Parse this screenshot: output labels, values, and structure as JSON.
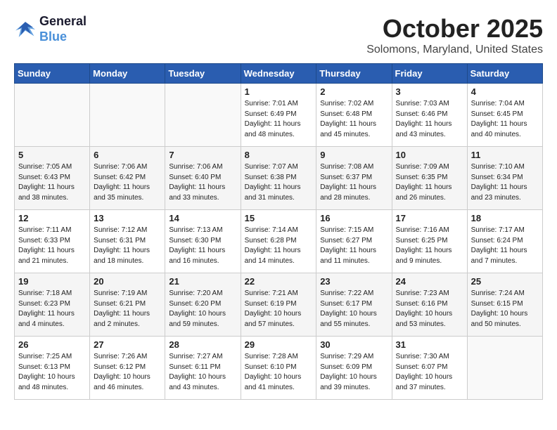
{
  "header": {
    "logo_line1": "General",
    "logo_line2": "Blue",
    "month": "October 2025",
    "location": "Solomons, Maryland, United States"
  },
  "weekdays": [
    "Sunday",
    "Monday",
    "Tuesday",
    "Wednesday",
    "Thursday",
    "Friday",
    "Saturday"
  ],
  "weeks": [
    [
      {
        "day": "",
        "info": ""
      },
      {
        "day": "",
        "info": ""
      },
      {
        "day": "",
        "info": ""
      },
      {
        "day": "1",
        "info": "Sunrise: 7:01 AM\nSunset: 6:49 PM\nDaylight: 11 hours\nand 48 minutes."
      },
      {
        "day": "2",
        "info": "Sunrise: 7:02 AM\nSunset: 6:48 PM\nDaylight: 11 hours\nand 45 minutes."
      },
      {
        "day": "3",
        "info": "Sunrise: 7:03 AM\nSunset: 6:46 PM\nDaylight: 11 hours\nand 43 minutes."
      },
      {
        "day": "4",
        "info": "Sunrise: 7:04 AM\nSunset: 6:45 PM\nDaylight: 11 hours\nand 40 minutes."
      }
    ],
    [
      {
        "day": "5",
        "info": "Sunrise: 7:05 AM\nSunset: 6:43 PM\nDaylight: 11 hours\nand 38 minutes."
      },
      {
        "day": "6",
        "info": "Sunrise: 7:06 AM\nSunset: 6:42 PM\nDaylight: 11 hours\nand 35 minutes."
      },
      {
        "day": "7",
        "info": "Sunrise: 7:06 AM\nSunset: 6:40 PM\nDaylight: 11 hours\nand 33 minutes."
      },
      {
        "day": "8",
        "info": "Sunrise: 7:07 AM\nSunset: 6:38 PM\nDaylight: 11 hours\nand 31 minutes."
      },
      {
        "day": "9",
        "info": "Sunrise: 7:08 AM\nSunset: 6:37 PM\nDaylight: 11 hours\nand 28 minutes."
      },
      {
        "day": "10",
        "info": "Sunrise: 7:09 AM\nSunset: 6:35 PM\nDaylight: 11 hours\nand 26 minutes."
      },
      {
        "day": "11",
        "info": "Sunrise: 7:10 AM\nSunset: 6:34 PM\nDaylight: 11 hours\nand 23 minutes."
      }
    ],
    [
      {
        "day": "12",
        "info": "Sunrise: 7:11 AM\nSunset: 6:33 PM\nDaylight: 11 hours\nand 21 minutes."
      },
      {
        "day": "13",
        "info": "Sunrise: 7:12 AM\nSunset: 6:31 PM\nDaylight: 11 hours\nand 18 minutes."
      },
      {
        "day": "14",
        "info": "Sunrise: 7:13 AM\nSunset: 6:30 PM\nDaylight: 11 hours\nand 16 minutes."
      },
      {
        "day": "15",
        "info": "Sunrise: 7:14 AM\nSunset: 6:28 PM\nDaylight: 11 hours\nand 14 minutes."
      },
      {
        "day": "16",
        "info": "Sunrise: 7:15 AM\nSunset: 6:27 PM\nDaylight: 11 hours\nand 11 minutes."
      },
      {
        "day": "17",
        "info": "Sunrise: 7:16 AM\nSunset: 6:25 PM\nDaylight: 11 hours\nand 9 minutes."
      },
      {
        "day": "18",
        "info": "Sunrise: 7:17 AM\nSunset: 6:24 PM\nDaylight: 11 hours\nand 7 minutes."
      }
    ],
    [
      {
        "day": "19",
        "info": "Sunrise: 7:18 AM\nSunset: 6:23 PM\nDaylight: 11 hours\nand 4 minutes."
      },
      {
        "day": "20",
        "info": "Sunrise: 7:19 AM\nSunset: 6:21 PM\nDaylight: 11 hours\nand 2 minutes."
      },
      {
        "day": "21",
        "info": "Sunrise: 7:20 AM\nSunset: 6:20 PM\nDaylight: 10 hours\nand 59 minutes."
      },
      {
        "day": "22",
        "info": "Sunrise: 7:21 AM\nSunset: 6:19 PM\nDaylight: 10 hours\nand 57 minutes."
      },
      {
        "day": "23",
        "info": "Sunrise: 7:22 AM\nSunset: 6:17 PM\nDaylight: 10 hours\nand 55 minutes."
      },
      {
        "day": "24",
        "info": "Sunrise: 7:23 AM\nSunset: 6:16 PM\nDaylight: 10 hours\nand 53 minutes."
      },
      {
        "day": "25",
        "info": "Sunrise: 7:24 AM\nSunset: 6:15 PM\nDaylight: 10 hours\nand 50 minutes."
      }
    ],
    [
      {
        "day": "26",
        "info": "Sunrise: 7:25 AM\nSunset: 6:13 PM\nDaylight: 10 hours\nand 48 minutes."
      },
      {
        "day": "27",
        "info": "Sunrise: 7:26 AM\nSunset: 6:12 PM\nDaylight: 10 hours\nand 46 minutes."
      },
      {
        "day": "28",
        "info": "Sunrise: 7:27 AM\nSunset: 6:11 PM\nDaylight: 10 hours\nand 43 minutes."
      },
      {
        "day": "29",
        "info": "Sunrise: 7:28 AM\nSunset: 6:10 PM\nDaylight: 10 hours\nand 41 minutes."
      },
      {
        "day": "30",
        "info": "Sunrise: 7:29 AM\nSunset: 6:09 PM\nDaylight: 10 hours\nand 39 minutes."
      },
      {
        "day": "31",
        "info": "Sunrise: 7:30 AM\nSunset: 6:07 PM\nDaylight: 10 hours\nand 37 minutes."
      },
      {
        "day": "",
        "info": ""
      }
    ]
  ]
}
